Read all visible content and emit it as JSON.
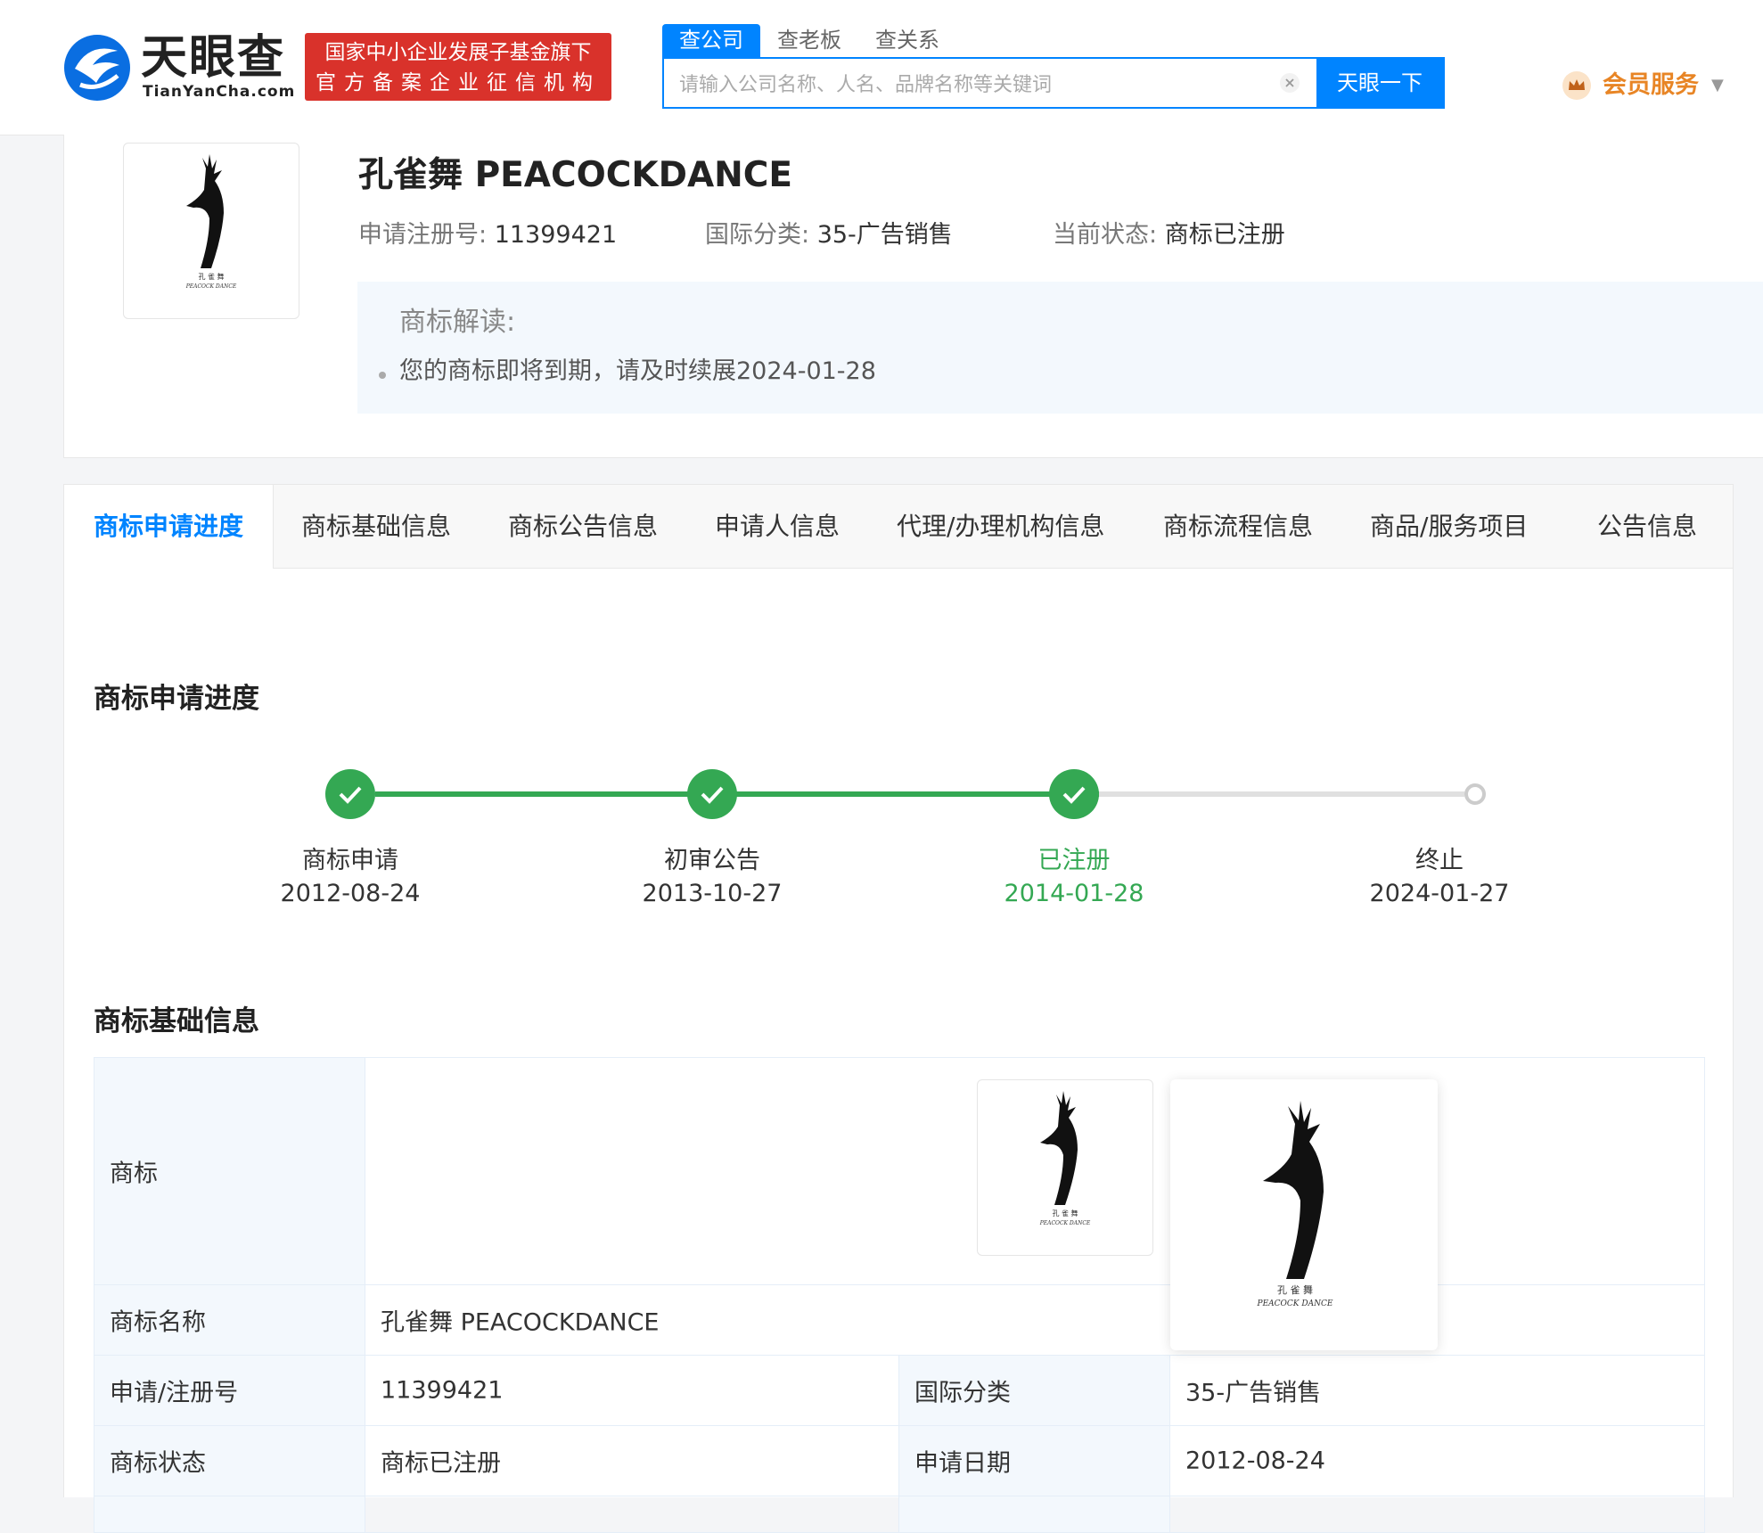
{
  "header": {
    "logo_cn": "天眼查",
    "logo_en": "TianYanCha.com",
    "gov_badge_line1": "国家中小企业发展子基金旗下",
    "gov_badge_line2": "官方备案企业征信机构",
    "search_tabs": [
      "查公司",
      "查老板",
      "查关系"
    ],
    "search_placeholder": "请输入公司名称、人名、品牌名称等关键词",
    "search_button": "天眼一下",
    "member_label": "会员服务"
  },
  "trademark": {
    "title": "孔雀舞 PEACOCKDANCE",
    "reg_no_label": "申请注册号:",
    "reg_no": "11399421",
    "class_label": "国际分类:",
    "class_value": "35-广告销售",
    "status_label": "当前状态:",
    "status_value": "商标已注册",
    "image_caption_cn": "孔 雀 舞",
    "image_caption_en": "PEACOCK DANCE"
  },
  "interpretation": {
    "title": "商标解读:",
    "items": [
      "您的商标即将到期，请及时续展2024-01-28"
    ]
  },
  "tabs": [
    "商标申请进度",
    "商标基础信息",
    "商标公告信息",
    "申请人信息",
    "代理/办理机构信息",
    "商标流程信息",
    "商品/服务项目",
    "公告信息"
  ],
  "progress": {
    "title": "商标申请进度",
    "steps": [
      {
        "label": "商标申请",
        "date": "2012-08-24",
        "status": "done"
      },
      {
        "label": "初审公告",
        "date": "2013-10-27",
        "status": "done"
      },
      {
        "label": "已注册",
        "date": "2014-01-28",
        "status": "current"
      },
      {
        "label": "终止",
        "date": "2024-01-27",
        "status": "pending"
      }
    ]
  },
  "basic_info": {
    "title": "商标基础信息",
    "rows": {
      "trademark_label": "商标",
      "name_label": "商标名称",
      "name_value": "孔雀舞 PEACOCKDANCE",
      "reg_label": "申请/注册号",
      "reg_value": "11399421",
      "class_label": "国际分类",
      "class_value": "35-广告销售",
      "status_label": "商标状态",
      "status_value": "商标已注册",
      "date_label": "申请日期",
      "date_value": "2012-08-24"
    }
  },
  "colors": {
    "brand_blue": "#0084ff",
    "badge_red": "#d9322b",
    "success_green": "#34a853",
    "member_orange": "#e88525"
  }
}
